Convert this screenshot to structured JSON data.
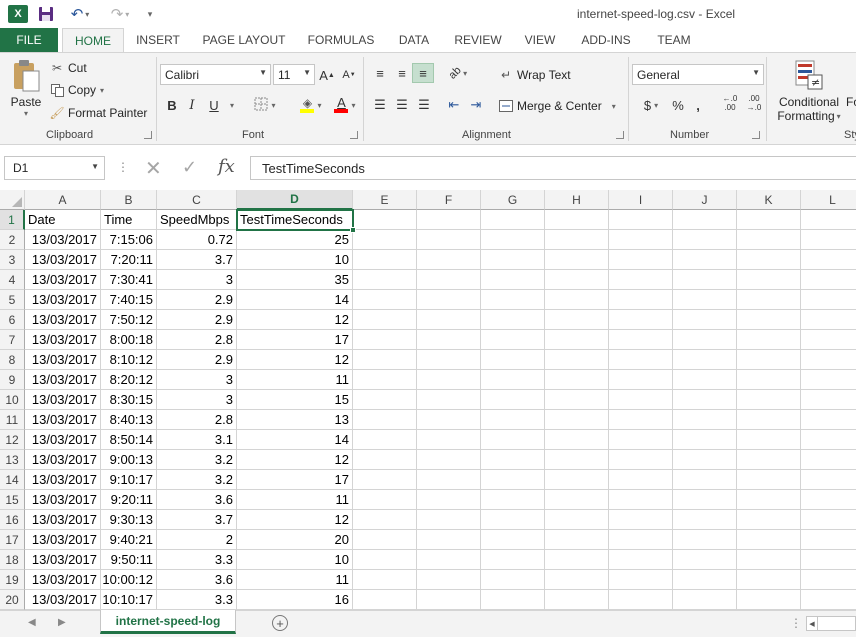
{
  "window": {
    "title": "internet-speed-log.csv - Excel"
  },
  "ribbon_tabs": {
    "file": "FILE",
    "tabs": [
      "HOME",
      "INSERT",
      "PAGE LAYOUT",
      "FORMULAS",
      "DATA",
      "REVIEW",
      "VIEW",
      "ADD-INS",
      "TEAM"
    ],
    "active": "HOME"
  },
  "clipboard": {
    "paste": "Paste",
    "cut": "Cut",
    "copy": "Copy",
    "format_painter": "Format Painter",
    "label": "Clipboard"
  },
  "font": {
    "name": "Calibri",
    "size": "11",
    "grow": "A",
    "shrink": "A",
    "bold": "B",
    "italic": "I",
    "underline": "U",
    "font_color_letter": "A",
    "label": "Font",
    "fill_color": "#ffff00",
    "text_color": "#ff0000"
  },
  "alignment": {
    "wrap_text": "Wrap Text",
    "merge_center": "Merge & Center",
    "label": "Alignment"
  },
  "number": {
    "format": "General",
    "currency": "$",
    "percent": "%",
    "comma": ",",
    "inc_decimal": "←.0 .00",
    "dec_decimal": ".00 →.0",
    "label": "Number"
  },
  "styles": {
    "conditional_line1": "Conditional",
    "conditional_line2": "Formatting",
    "cut_off_label": "Fo",
    "cut_off_group": "Sty"
  },
  "formula_bar": {
    "name_box": "D1",
    "content": "TestTimeSeconds",
    "fx": "fx"
  },
  "grid": {
    "columns": [
      "A",
      "B",
      "C",
      "D",
      "E",
      "F",
      "G",
      "H",
      "I",
      "J",
      "K",
      "L"
    ],
    "selected_column": "D",
    "selected_row": 1,
    "header_row": [
      "Date",
      "Time",
      "SpeedMbps",
      "TestTimeSeconds"
    ],
    "rows": [
      [
        "13/03/2017",
        "7:15:06",
        "0.72",
        "25"
      ],
      [
        "13/03/2017",
        "7:20:11",
        "3.7",
        "10"
      ],
      [
        "13/03/2017",
        "7:30:41",
        "3",
        "35"
      ],
      [
        "13/03/2017",
        "7:40:15",
        "2.9",
        "14"
      ],
      [
        "13/03/2017",
        "7:50:12",
        "2.9",
        "12"
      ],
      [
        "13/03/2017",
        "8:00:18",
        "2.8",
        "17"
      ],
      [
        "13/03/2017",
        "8:10:12",
        "2.9",
        "12"
      ],
      [
        "13/03/2017",
        "8:20:12",
        "3",
        "11"
      ],
      [
        "13/03/2017",
        "8:30:15",
        "3",
        "15"
      ],
      [
        "13/03/2017",
        "8:40:13",
        "2.8",
        "13"
      ],
      [
        "13/03/2017",
        "8:50:14",
        "3.1",
        "14"
      ],
      [
        "13/03/2017",
        "9:00:13",
        "3.2",
        "12"
      ],
      [
        "13/03/2017",
        "9:10:17",
        "3.2",
        "17"
      ],
      [
        "13/03/2017",
        "9:20:11",
        "3.6",
        "11"
      ],
      [
        "13/03/2017",
        "9:30:13",
        "3.7",
        "12"
      ],
      [
        "13/03/2017",
        "9:40:21",
        "2",
        "20"
      ],
      [
        "13/03/2017",
        "9:50:11",
        "3.3",
        "10"
      ],
      [
        "13/03/2017",
        "10:00:12",
        "3.6",
        "11"
      ],
      [
        "13/03/2017",
        "10:10:17",
        "3.3",
        "16"
      ]
    ],
    "row_numbers": [
      "1",
      "2",
      "3",
      "4",
      "5",
      "6",
      "7",
      "8",
      "9",
      "10",
      "11",
      "12",
      "13",
      "14",
      "15",
      "16",
      "17",
      "18",
      "19",
      "20"
    ]
  },
  "sheets": {
    "active": "internet-speed-log",
    "add": "+"
  },
  "colors": {
    "excel_green": "#217346",
    "ribbon_bg": "#f3f3f3",
    "gridline": "#d4d4d4"
  }
}
